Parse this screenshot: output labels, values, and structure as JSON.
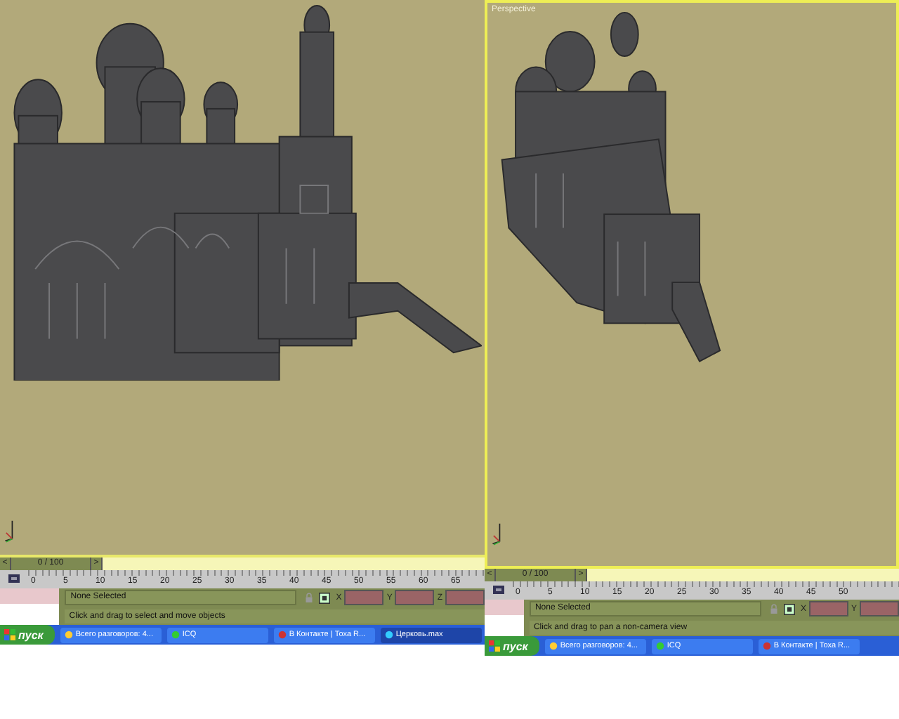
{
  "panels": [
    {
      "viewport": {
        "active": false,
        "prev": "<",
        "next": ">",
        "time": "0 / 100",
        "ruler": [
          "0",
          "5",
          "10",
          "15",
          "20",
          "25",
          "30",
          "35",
          "40",
          "45",
          "50",
          "55",
          "60",
          "65"
        ]
      },
      "status": {
        "selection": "None Selected",
        "prompt": "Click and drag to select and move objects",
        "coords": [
          "X",
          "Y",
          "Z"
        ]
      },
      "taskbar": {
        "start": "пуск",
        "items": [
          {
            "label": "Всего разговоров: 4...",
            "selected": false
          },
          {
            "label": "ICQ",
            "selected": false
          },
          {
            "label": "В Контакте | Тоха R...",
            "selected": false
          },
          {
            "label": "Церковь.max",
            "selected": true
          }
        ]
      }
    },
    {
      "viewport": {
        "active": true,
        "label": "Perspective",
        "prev": "<",
        "next": ">",
        "time": "0 / 100",
        "ruler": [
          "0",
          "5",
          "10",
          "15",
          "20",
          "25",
          "30",
          "35",
          "40",
          "45",
          "50"
        ]
      },
      "status": {
        "selection": "None Selected",
        "prompt": "Click and drag to pan a non-camera view",
        "coords": [
          "X",
          "Y"
        ]
      },
      "taskbar": {
        "start": "пуск",
        "items": [
          {
            "label": "Всего разговоров: 4...",
            "selected": false
          },
          {
            "label": "ICQ",
            "selected": false
          },
          {
            "label": "В Контакте | Тоха R...",
            "selected": false
          }
        ]
      }
    }
  ]
}
